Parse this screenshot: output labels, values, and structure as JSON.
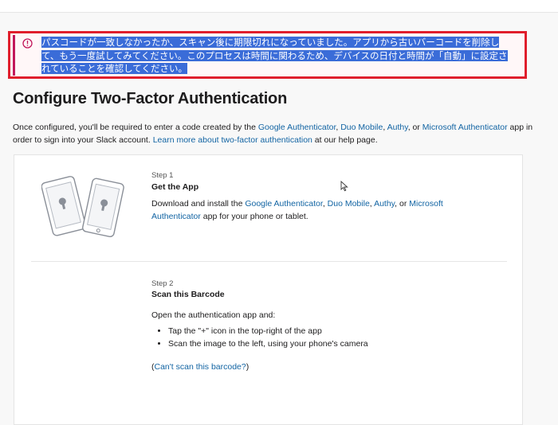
{
  "alert": {
    "icon": "exclamation-circle-icon",
    "color": "#e01e2c",
    "message": "パスコードが一致しなかったか、スキャン後に期限切れになっていました。アプリから古いバーコードを削除して、もう一度試してみてください。このプロセスは時間に関わるため、デバイスの日付と時間が「自動」に設定されていることを確認してください。"
  },
  "page": {
    "title": "Configure Two-Factor Authentication",
    "intro": {
      "t1": "Once configured, you'll be required to enter a code created by the ",
      "link_google": "Google Authenticator",
      "t2": ", ",
      "link_duo": "Duo Mobile",
      "t3": ", ",
      "link_authy": "Authy",
      "t4": ", or ",
      "link_microsoft": "Microsoft Authenticator",
      "t5": " app in order to sign into your Slack account. ",
      "link_learn": "Learn more about two-factor authentication",
      "t6": " at our help page."
    }
  },
  "step1": {
    "label": "Step 1",
    "title": "Get the App",
    "t1": "Download and install the ",
    "link_google": "Google Authenticator",
    "t2": ", ",
    "link_duo": "Duo Mobile",
    "t3": ", ",
    "link_authy": "Authy",
    "t4": ", or ",
    "link_microsoft": "Microsoft Authenticator",
    "t5": " app for your phone or tablet."
  },
  "step2": {
    "label": "Step 2",
    "title": "Scan this Barcode",
    "lead": "Open the authentication app and:",
    "items": [
      "Tap the \"+\" icon in the top-right of the app",
      "Scan the image to the left, using your phone's camera"
    ],
    "paren_open": "(",
    "link_cant_scan": "Can't scan this barcode?",
    "paren_close": ")"
  },
  "colors": {
    "link": "#1264a3",
    "selection": "#3a6cd8",
    "error": "#e01e2c"
  }
}
